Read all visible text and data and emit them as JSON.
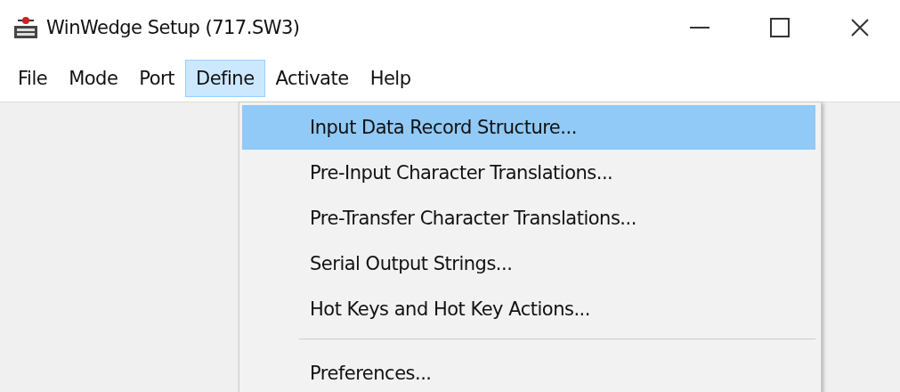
{
  "window": {
    "title": "WinWedge Setup (717.SW3)"
  },
  "menu_bar": [
    {
      "label": "File",
      "selected": false
    },
    {
      "label": "Mode",
      "selected": false
    },
    {
      "label": "Port",
      "selected": false
    },
    {
      "label": "Define",
      "selected": true
    },
    {
      "label": "Activate",
      "selected": false
    },
    {
      "label": "Help",
      "selected": false
    }
  ],
  "dropdown": [
    {
      "kind": "item",
      "label": "Input Data Record Structure...",
      "selected": true
    },
    {
      "kind": "item",
      "label": "Pre-Input Character Translations...",
      "selected": false
    },
    {
      "kind": "item",
      "label": "Pre-Transfer Character Translations...",
      "selected": false
    },
    {
      "kind": "item",
      "label": "Serial Output Strings...",
      "selected": false
    },
    {
      "kind": "item",
      "label": "Hot Keys and Hot Key Actions...",
      "selected": false
    },
    {
      "kind": "separator"
    },
    {
      "kind": "item",
      "label": "Preferences...",
      "selected": false
    }
  ]
}
